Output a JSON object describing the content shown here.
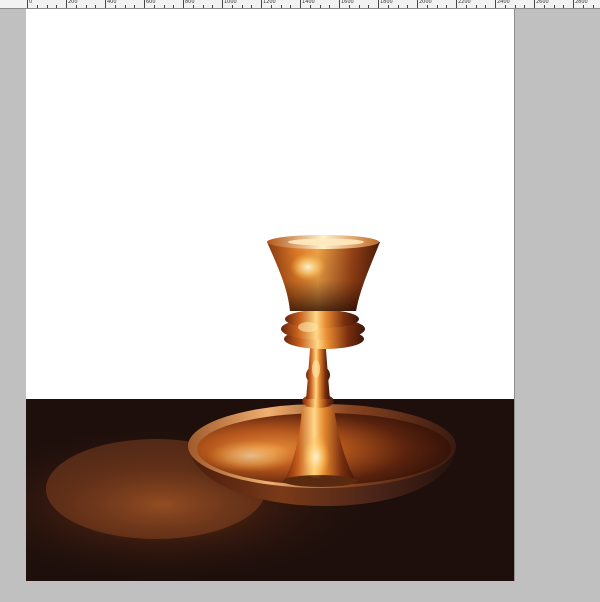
{
  "ruler": {
    "labels": [
      "0",
      "200",
      "400",
      "600",
      "800",
      "1000",
      "1200",
      "1400",
      "1600",
      "1800",
      "2000",
      "2200",
      "2400",
      "2600",
      "2800"
    ]
  },
  "colors": {
    "workspace": "#c0c0c0",
    "background_wall": "#ffffff",
    "table_surface": "#1e0f0c",
    "brass_light": "#f7c56a",
    "brass_mid": "#c8621e",
    "brass_dark": "#3d160a"
  },
  "artwork": {
    "subject": "brass-candle-holder-icon"
  }
}
